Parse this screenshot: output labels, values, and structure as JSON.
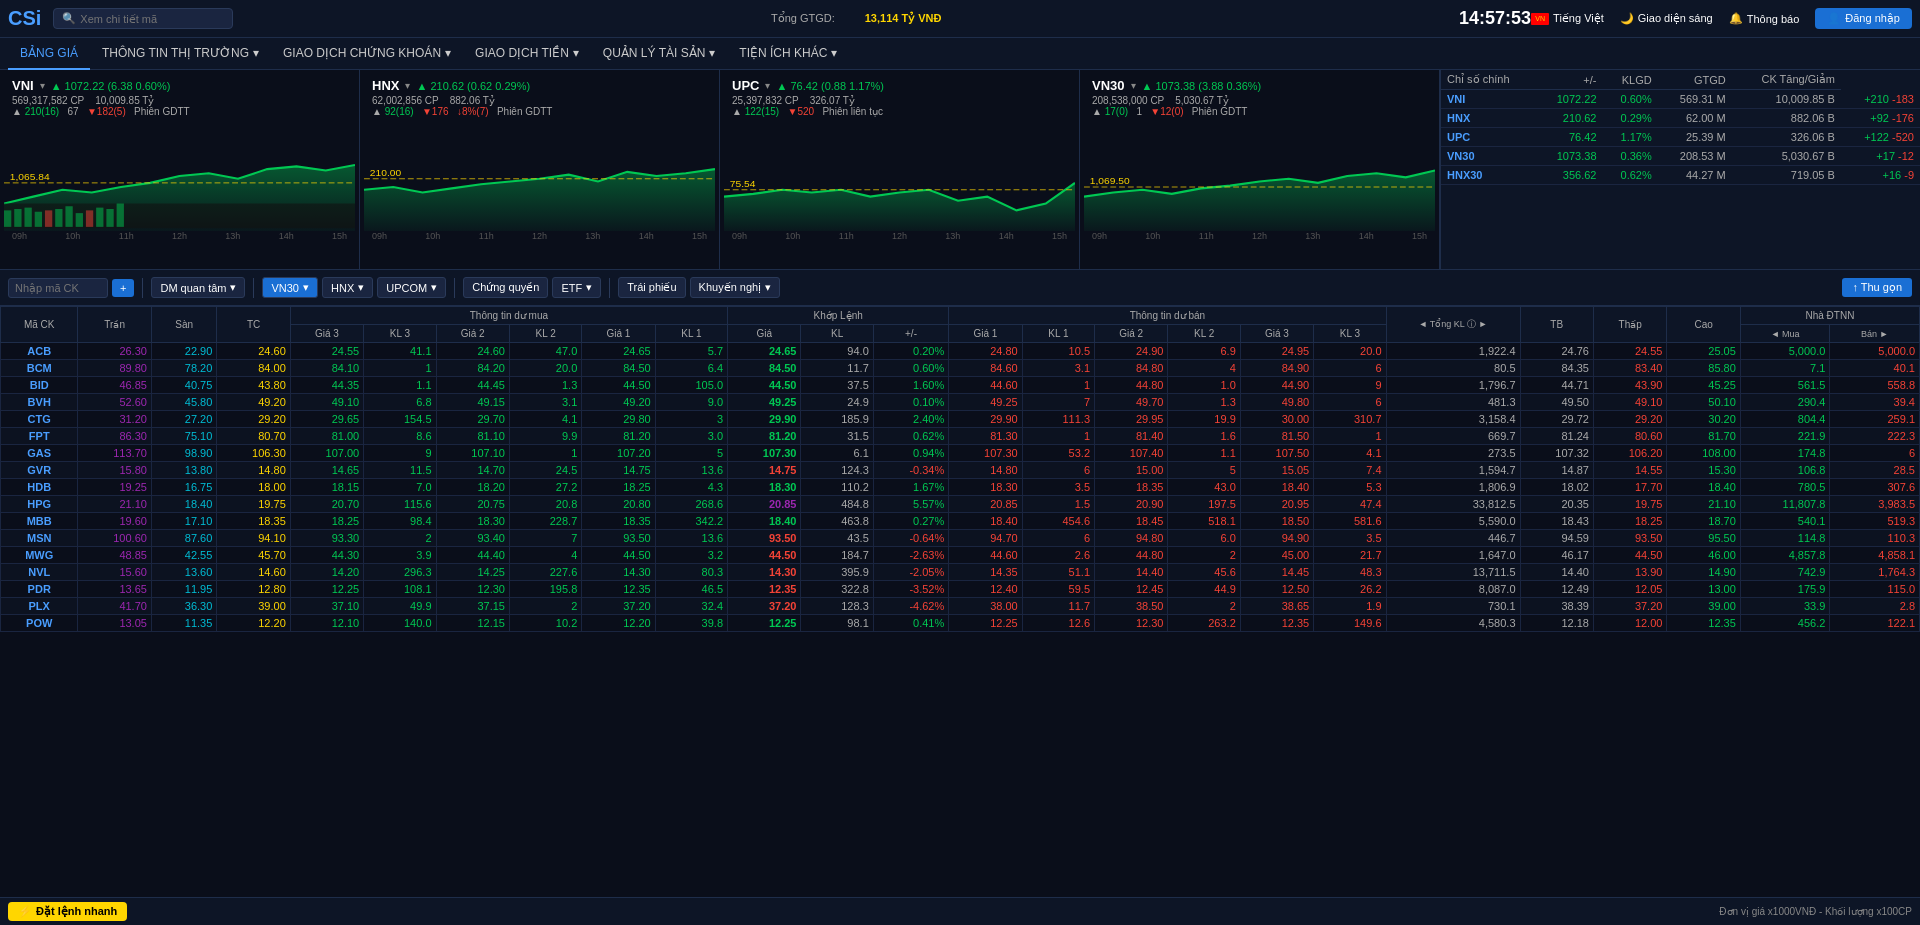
{
  "header": {
    "logo": "CSi",
    "search_placeholder": "Xem chi tiết mã",
    "total_label": "Tổng GTGD:",
    "total_value": "13,114 Tỷ VNĐ",
    "time": "14:57:53",
    "lang": "Tiếng Việt",
    "theme": "Giao diện sáng",
    "notif": "Thông báo",
    "login": "Đăng nhập"
  },
  "nav": {
    "items": [
      {
        "label": "BẢNG GIÁ",
        "active": true
      },
      {
        "label": "THÔNG TIN THỊ TRƯỜNG",
        "active": false
      },
      {
        "label": "GIAO DỊCH CHỨNG KHOÁN",
        "active": false
      },
      {
        "label": "GIAO DỊCH TIỀN",
        "active": false
      },
      {
        "label": "QUẢN LÝ TÀI SẢN",
        "active": false
      },
      {
        "label": "TIỆN ÍCH KHÁC",
        "active": false
      }
    ]
  },
  "indices": [
    {
      "name": "VNI",
      "price": "1,072.22",
      "change": "+6.38",
      "change_pct": "0.60%",
      "volume": "569,317,582 CP",
      "value": "10,009.85 Tỷ",
      "up": "210(16)",
      "unchanged": "67",
      "down": "182(5)",
      "session": "Phiên GDTT",
      "label_price": "1,065.84",
      "color": "green"
    },
    {
      "name": "HNX",
      "price": "210.62",
      "change": "+0.62",
      "change_pct": "0.29%",
      "volume": "62,002,856 CP",
      "value": "882.06 Tỷ",
      "up": "92(16)",
      "unchanged": "",
      "down": "176",
      "session": "Phiên GDTT",
      "label_price": "210.00",
      "color": "green"
    },
    {
      "name": "UPC",
      "price": "76.42",
      "change": "+0.88",
      "change_pct": "1.17%",
      "volume": "25,397,832 CP",
      "value": "326.07 Tỷ",
      "up": "122(15)",
      "unchanged": "",
      "down": "520",
      "session": "Phiên liên tục",
      "label_price": "75.54",
      "color": "green"
    },
    {
      "name": "VN30",
      "price": "1,073.38",
      "change": "+3.88",
      "change_pct": "0.36%",
      "volume": "208,538,000 CP",
      "value": "5,030.67 Tỷ",
      "up": "17(0)",
      "unchanged": "1",
      "down": "12(0)",
      "session": "Phiên GDTT",
      "label_price": "1,069.50",
      "color": "green"
    }
  ],
  "index_table": {
    "headers": [
      "Chỉ số chính",
      "+/-",
      "KLGD",
      "GTGD",
      "CK Tăng/Giảm"
    ],
    "rows": [
      {
        "name": "VNI",
        "price": "1072.22",
        "pct": "0.60%",
        "klgd": "569.31 M",
        "gtgd": "10,009.85 B",
        "up": "+210",
        "down": "-183",
        "color": "green"
      },
      {
        "name": "HNX",
        "price": "210.62",
        "pct": "0.29%",
        "klgd": "62.00 M",
        "gtgd": "882.06 B",
        "up": "+92",
        "down": "-176",
        "color": "green"
      },
      {
        "name": "UPC",
        "price": "76.42",
        "pct": "1.17%",
        "klgd": "25.39 M",
        "gtgd": "326.06 B",
        "up": "+122",
        "down": "-520",
        "color": "green"
      },
      {
        "name": "VN30",
        "price": "1073.38",
        "pct": "0.36%",
        "klgd": "208.53 M",
        "gtgd": "5,030.67 B",
        "up": "+17",
        "down": "-12",
        "color": "green"
      },
      {
        "name": "HNX30",
        "price": "356.62",
        "pct": "0.62%",
        "klgd": "44.27 M",
        "gtgd": "719.05 B",
        "up": "+16",
        "down": "-9",
        "color": "green"
      }
    ]
  },
  "toolbar": {
    "search_placeholder": "Nhập mã CK",
    "dm_quan_tam": "DM quan tâm",
    "vn30": "VN30",
    "hnx": "HNX",
    "upcom": "UPCOM",
    "chung_quyen": "Chứng quyền",
    "etf": "ETF",
    "trai_phieu": "Trái phiếu",
    "khuyen_nghi": "Khuyến nghị",
    "thu_gon": "↑ Thu gọn"
  },
  "table_headers": {
    "ma_ck": "Mã CK",
    "tran": "Trần",
    "san": "Sàn",
    "tc": "TC",
    "thong_tin_du_mua": "Thông tin dư mua",
    "gia3": "Giá 3",
    "kl3_mua": "KL 3",
    "gia2_mua": "Giá 2",
    "kl2_mua": "KL 2",
    "gia1_mua": "Giá 1",
    "kl1_mua": "KL 1",
    "khop_lenh": "Khớp Lệnh",
    "gia_kl": "Giá",
    "kl": "KL",
    "plus_minus": "+/-",
    "thong_tin_du_ban": "Thông tin dư bán",
    "gia1_ban": "Giá 1",
    "kl1_ban": "KL 1",
    "gia2_ban": "Giá 2",
    "kl2_ban": "KL 2",
    "gia3_ban": "Giá 3",
    "kl3_ban": "KL 3",
    "tong_kl": "◄ Tổng KL ⓘ ►",
    "tb": "TB",
    "thap": "Thấp",
    "cao": "Cao",
    "nha_dtnn": "Nhà ĐTNN",
    "mua": "◄ Mua",
    "ban": "Bán ►"
  },
  "stocks": [
    {
      "code": "ACB",
      "tran": "26.30",
      "san": "22.90",
      "tc": "24.60",
      "g3m": "24.55",
      "kl3m": "41.1",
      "g2m": "24.60",
      "kl2m": "47.0",
      "g1m": "24.65",
      "kl1m": "5.7",
      "gia": "24.65",
      "kl": "94.0",
      "pm": "0.20%",
      "g1b": "24.80",
      "kl1b": "10.5",
      "g2b": "24.90",
      "kl2b": "6.9",
      "g3b": "24.95",
      "kl3b": "20.0",
      "tong_kl": "1,922.4",
      "tb": "24.76",
      "thap": "24.55",
      "cao": "25.05",
      "mua": "5,000.0",
      "ban": "5,000.0",
      "pm_color": "green",
      "gia_color": "green"
    },
    {
      "code": "BCM",
      "tran": "89.80",
      "san": "78.20",
      "tc": "84.00",
      "g3m": "84.10",
      "kl3m": "1",
      "g2m": "84.20",
      "kl2m": "20.0",
      "g1m": "84.50",
      "kl1m": "6.4",
      "gia": "84.50",
      "kl": "11.7",
      "pm": "0.60%",
      "g1b": "84.60",
      "kl1b": "3.1",
      "g2b": "84.80",
      "kl2b": "4",
      "g3b": "84.90",
      "kl3b": "6",
      "tong_kl": "80.5",
      "tb": "84.35",
      "thap": "83.40",
      "cao": "85.80",
      "mua": "7.1",
      "ban": "40.1",
      "pm_color": "green",
      "gia_color": "green"
    },
    {
      "code": "BID",
      "tran": "46.85",
      "san": "40.75",
      "tc": "43.80",
      "g3m": "44.35",
      "kl3m": "1.1",
      "g2m": "44.45",
      "kl2m": "1.3",
      "g1m": "44.50",
      "kl1m": "105.0",
      "gia": "44.50",
      "kl": "37.5",
      "pm": "1.60%",
      "g1b": "44.60",
      "kl1b": "1",
      "g2b": "44.80",
      "kl2b": "1.0",
      "g3b": "44.90",
      "kl3b": "9",
      "tong_kl": "1,796.7",
      "tb": "44.71",
      "thap": "43.90",
      "cao": "45.25",
      "mua": "561.5",
      "ban": "558.8",
      "pm_color": "green",
      "gia_color": "green"
    },
    {
      "code": "BVH",
      "tran": "52.60",
      "san": "45.80",
      "tc": "49.20",
      "g3m": "49.10",
      "kl3m": "6.8",
      "g2m": "49.15",
      "kl2m": "3.1",
      "g1m": "49.20",
      "kl1m": "9.0",
      "gia": "49.25",
      "kl": "24.9",
      "pm": "0.10%",
      "g1b": "49.25",
      "kl1b": "7",
      "g2b": "49.70",
      "kl2b": "1.3",
      "g3b": "49.80",
      "kl3b": "6",
      "tong_kl": "481.3",
      "tb": "49.50",
      "thap": "49.10",
      "cao": "50.10",
      "mua": "290.4",
      "ban": "39.4",
      "pm_color": "green",
      "gia_color": "green"
    },
    {
      "code": "CTG",
      "tran": "31.20",
      "san": "27.20",
      "tc": "29.20",
      "g3m": "29.65",
      "kl3m": "154.5",
      "g2m": "29.70",
      "kl2m": "4.1",
      "g1m": "29.80",
      "kl1m": "3",
      "gia": "29.90",
      "kl": "185.9",
      "pm": "2.40%",
      "g1b": "29.90",
      "kl1b": "111.3",
      "g2b": "29.95",
      "kl2b": "19.9",
      "g3b": "30.00",
      "kl3b": "310.7",
      "tong_kl": "3,158.4",
      "tb": "29.72",
      "thap": "29.20",
      "cao": "30.20",
      "mua": "804.4",
      "ban": "259.1",
      "pm_color": "green",
      "gia_color": "green"
    },
    {
      "code": "FPT",
      "tran": "86.30",
      "san": "75.10",
      "tc": "80.70",
      "g3m": "81.00",
      "kl3m": "8.6",
      "g2m": "81.10",
      "kl2m": "9.9",
      "g1m": "81.20",
      "kl1m": "3.0",
      "gia": "81.20",
      "kl": "31.5",
      "pm": "0.62%",
      "g1b": "81.30",
      "kl1b": "1",
      "g2b": "81.40",
      "kl2b": "1.6",
      "g3b": "81.50",
      "kl3b": "1",
      "tong_kl": "669.7",
      "tb": "81.24",
      "thap": "80.60",
      "cao": "81.70",
      "mua": "221.9",
      "ban": "222.3",
      "pm_color": "green",
      "gia_color": "green"
    },
    {
      "code": "GAS",
      "tran": "113.70",
      "san": "98.90",
      "tc": "106.30",
      "g3m": "107.00",
      "kl3m": "9",
      "g2m": "107.10",
      "kl2m": "1",
      "g1m": "107.20",
      "kl1m": "5",
      "gia": "107.30",
      "kl": "6.1",
      "pm": "0.94%",
      "g1b": "107.30",
      "kl1b": "53.2",
      "g2b": "107.40",
      "kl2b": "1.1",
      "g3b": "107.50",
      "kl3b": "4.1",
      "tong_kl": "273.5",
      "tb": "107.32",
      "thap": "106.20",
      "cao": "108.00",
      "mua": "174.8",
      "ban": "6",
      "pm_color": "green",
      "gia_color": "green"
    },
    {
      "code": "GVR",
      "tran": "15.80",
      "san": "13.80",
      "tc": "14.80",
      "g3m": "14.65",
      "kl3m": "11.5",
      "g2m": "14.70",
      "kl2m": "24.5",
      "g1m": "14.75",
      "kl1m": "13.6",
      "gia": "14.75",
      "kl": "124.3",
      "pm": "-0.34%",
      "g1b": "14.80",
      "kl1b": "6",
      "g2b": "15.00",
      "kl2b": "5",
      "g3b": "15.05",
      "kl3b": "7.4",
      "tong_kl": "1,594.7",
      "tb": "14.87",
      "thap": "14.55",
      "cao": "15.30",
      "mua": "106.8",
      "ban": "28.5",
      "pm_color": "red",
      "gia_color": "red"
    },
    {
      "code": "HDB",
      "tran": "19.25",
      "san": "16.75",
      "tc": "18.00",
      "g3m": "18.15",
      "kl3m": "7.0",
      "g2m": "18.20",
      "kl2m": "27.2",
      "g1m": "18.25",
      "kl1m": "4.3",
      "gia": "18.30",
      "kl": "110.2",
      "pm": "1.67%",
      "g1b": "18.30",
      "kl1b": "3.5",
      "g2b": "18.35",
      "kl2b": "43.0",
      "g3b": "18.40",
      "kl3b": "5.3",
      "tong_kl": "1,806.9",
      "tb": "18.02",
      "thap": "17.70",
      "cao": "18.40",
      "mua": "780.5",
      "ban": "307.6",
      "pm_color": "green",
      "gia_color": "green"
    },
    {
      "code": "HPG",
      "tran": "21.10",
      "san": "18.40",
      "tc": "19.75",
      "g3m": "20.70",
      "kl3m": "115.6",
      "g2m": "20.75",
      "kl2m": "20.8",
      "g1m": "20.80",
      "kl1m": "268.6",
      "gia": "20.85",
      "kl": "484.8",
      "pm": "5.57%",
      "g1b": "20.85",
      "kl1b": "1.5",
      "g2b": "20.90",
      "kl2b": "197.5",
      "g3b": "20.95",
      "kl3b": "47.4",
      "tong_kl": "33,812.5",
      "tb": "20.35",
      "thap": "19.75",
      "cao": "21.10",
      "mua": "11,807.8",
      "ban": "3,983.5",
      "pm_color": "green",
      "gia_color": "ceil"
    },
    {
      "code": "MBB",
      "tran": "19.60",
      "san": "17.10",
      "tc": "18.35",
      "g3m": "18.25",
      "kl3m": "98.4",
      "g2m": "18.30",
      "kl2m": "228.7",
      "g1m": "18.35",
      "kl1m": "342.2",
      "gia": "18.40",
      "kl": "463.8",
      "pm": "0.27%",
      "g1b": "18.40",
      "kl1b": "454.6",
      "g2b": "18.45",
      "kl2b": "518.1",
      "g3b": "18.50",
      "kl3b": "581.6",
      "tong_kl": "5,590.0",
      "tb": "18.43",
      "thap": "18.25",
      "cao": "18.70",
      "mua": "540.1",
      "ban": "519.3",
      "pm_color": "green",
      "gia_color": "green"
    },
    {
      "code": "MSN",
      "tran": "100.60",
      "san": "87.60",
      "tc": "94.10",
      "g3m": "93.30",
      "kl3m": "2",
      "g2m": "93.40",
      "kl2m": "7",
      "g1m": "93.50",
      "kl1m": "13.6",
      "gia": "93.50",
      "kl": "43.5",
      "pm": "-0.64%",
      "g1b": "94.70",
      "kl1b": "6",
      "g2b": "94.80",
      "kl2b": "6.0",
      "g3b": "94.90",
      "kl3b": "3.5",
      "tong_kl": "446.7",
      "tb": "94.59",
      "thap": "93.50",
      "cao": "95.50",
      "mua": "114.8",
      "ban": "110.3",
      "pm_color": "red",
      "gia_color": "red"
    },
    {
      "code": "MWG",
      "tran": "48.85",
      "san": "42.55",
      "tc": "45.70",
      "g3m": "44.30",
      "kl3m": "3.9",
      "g2m": "44.40",
      "kl2m": "4",
      "g1m": "44.50",
      "kl1m": "3.2",
      "gia": "44.50",
      "kl": "184.7",
      "pm": "-2.63%",
      "g1b": "44.60",
      "kl1b": "2.6",
      "g2b": "44.80",
      "kl2b": "2",
      "g3b": "45.00",
      "kl3b": "21.7",
      "tong_kl": "1,647.0",
      "tb": "46.17",
      "thap": "44.50",
      "cao": "46.00",
      "mua": "4,857.8",
      "ban": "4,858.1",
      "pm_color": "red",
      "gia_color": "red"
    },
    {
      "code": "NVL",
      "tran": "15.60",
      "san": "13.60",
      "tc": "14.60",
      "g3m": "14.20",
      "kl3m": "296.3",
      "g2m": "14.25",
      "kl2m": "227.6",
      "g1m": "14.30",
      "kl1m": "80.3",
      "gia": "14.30",
      "kl": "395.9",
      "pm": "-2.05%",
      "g1b": "14.35",
      "kl1b": "51.1",
      "g2b": "14.40",
      "kl2b": "45.6",
      "g3b": "14.45",
      "kl3b": "48.3",
      "tong_kl": "13,711.5",
      "tb": "14.40",
      "thap": "13.90",
      "cao": "14.90",
      "mua": "742.9",
      "ban": "1,764.3",
      "pm_color": "red",
      "gia_color": "red"
    },
    {
      "code": "PDR",
      "tran": "13.65",
      "san": "11.95",
      "tc": "12.80",
      "g3m": "12.25",
      "kl3m": "108.1",
      "g2m": "12.30",
      "kl2m": "195.8",
      "g1m": "12.35",
      "kl1m": "46.5",
      "gia": "12.35",
      "kl": "322.8",
      "pm": "-3.52%",
      "g1b": "12.40",
      "kl1b": "59.5",
      "g2b": "12.45",
      "kl2b": "44.9",
      "g3b": "12.50",
      "kl3b": "26.2",
      "tong_kl": "8,087.0",
      "tb": "12.49",
      "thap": "12.05",
      "cao": "13.00",
      "mua": "175.9",
      "ban": "115.0",
      "pm_color": "red",
      "gia_color": "red"
    },
    {
      "code": "PLX",
      "tran": "41.70",
      "san": "36.30",
      "tc": "39.00",
      "g3m": "37.10",
      "kl3m": "49.9",
      "g2m": "37.15",
      "kl2m": "2",
      "g1m": "37.20",
      "kl1m": "32.4",
      "gia": "37.20",
      "kl": "128.3",
      "pm": "-4.62%",
      "g1b": "38.00",
      "kl1b": "11.7",
      "g2b": "38.50",
      "kl2b": "2",
      "g3b": "38.65",
      "kl3b": "1.9",
      "tong_kl": "730.1",
      "tb": "38.39",
      "thap": "37.20",
      "cao": "39.00",
      "mua": "33.9",
      "ban": "2.8",
      "pm_color": "red",
      "gia_color": "red"
    },
    {
      "code": "POW",
      "tran": "13.05",
      "san": "11.35",
      "tc": "12.20",
      "g3m": "12.10",
      "kl3m": "140.0",
      "g2m": "12.15",
      "kl2m": "10.2",
      "g1m": "12.20",
      "kl1m": "39.8",
      "gia": "12.25",
      "kl": "98.1",
      "pm": "0.41%",
      "g1b": "12.25",
      "kl1b": "12.6",
      "g2b": "12.30",
      "kl2b": "263.2",
      "g3b": "12.35",
      "kl3b": "149.6",
      "tong_kl": "4,580.3",
      "tb": "12.18",
      "thap": "12.00",
      "cao": "12.35",
      "mua": "456.2",
      "ban": "122.1",
      "pm_color": "green",
      "gia_color": "green"
    }
  ],
  "footer": {
    "dat_lenh": "Đặt lệnh nhanh",
    "note": "Đơn vị giá x1000VNĐ - Khối lượng x100CP"
  }
}
